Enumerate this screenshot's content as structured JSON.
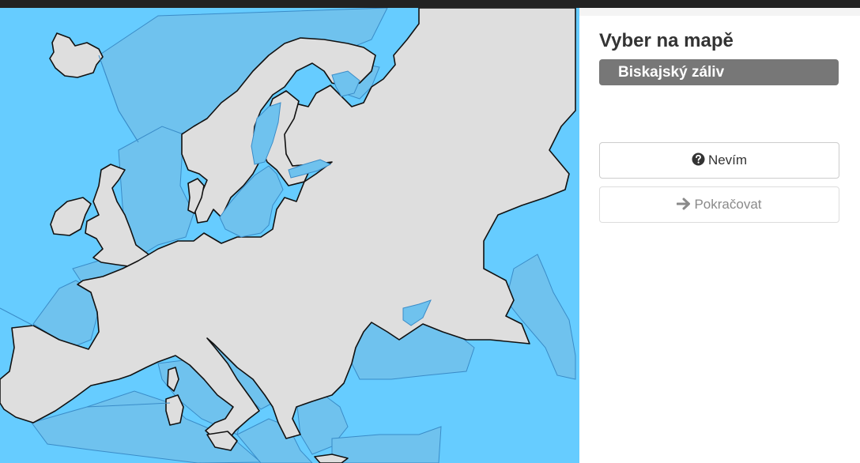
{
  "quiz": {
    "prompt": "Vyber na mapě",
    "target_item": "Biskajský záliv"
  },
  "buttons": {
    "dont_know_label": "Nevím",
    "continue_label": "Pokračovat"
  },
  "icons": {
    "dont_know": "question-circle-icon",
    "continue": "arrow-right-icon"
  },
  "colors": {
    "sea": "#66ccff",
    "sea_zone": "#6fc2ee",
    "land": "#dedede",
    "badge": "#777777"
  }
}
